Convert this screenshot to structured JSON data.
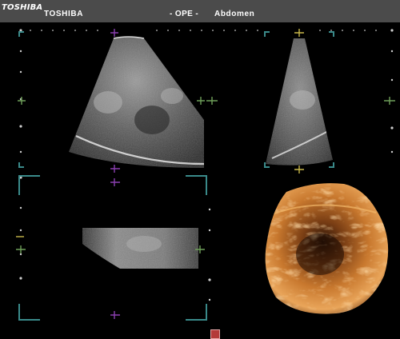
{
  "header": {
    "logo": "TOSHIBA",
    "brand": "TOSHIBA",
    "mode": "- OPE -",
    "preset": "Abdomen"
  },
  "colors": {
    "header_bg": "#4b4b4b",
    "frame_cyan": "#3a8a8a",
    "marker_green": "#6fa05a",
    "marker_purple": "#8a3fb0",
    "marker_yellow": "#c9b84a",
    "render_orange": "#c8782e",
    "swatch_red": "#b43a3a"
  },
  "icons": [
    "plane-marker-icon",
    "color-swatch-icon",
    "depth-scale-dots"
  ]
}
